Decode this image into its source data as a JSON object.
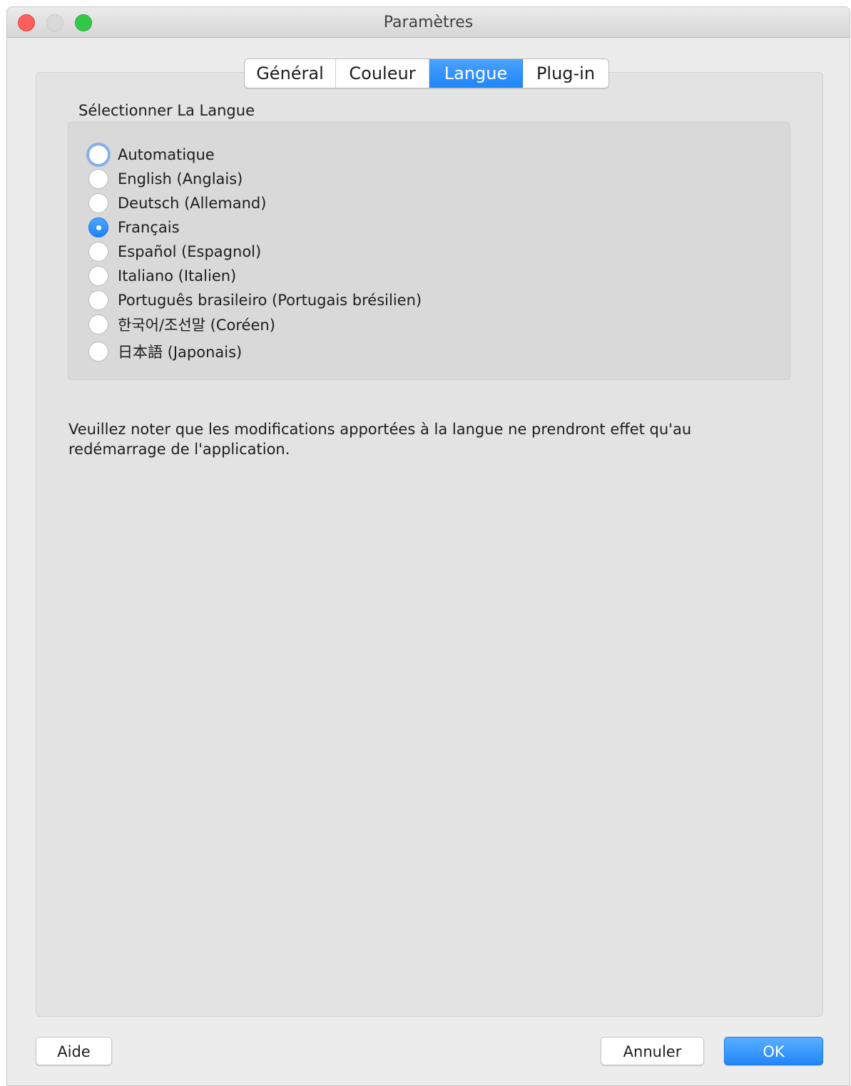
{
  "window": {
    "title": "Paramètres"
  },
  "tabs": [
    {
      "label": "Général",
      "selected": false
    },
    {
      "label": "Couleur",
      "selected": false
    },
    {
      "label": "Langue",
      "selected": true
    },
    {
      "label": "Plug-in",
      "selected": false
    }
  ],
  "language_section": {
    "label": "Sélectionner La Langue",
    "selected_value": "Français",
    "options": [
      {
        "label": "Automatique",
        "checked": false,
        "focused": true
      },
      {
        "label": "English (Anglais)",
        "checked": false,
        "focused": false
      },
      {
        "label": "Deutsch (Allemand)",
        "checked": false,
        "focused": false
      },
      {
        "label": "Français",
        "checked": true,
        "focused": false
      },
      {
        "label": "Español (Espagnol)",
        "checked": false,
        "focused": false
      },
      {
        "label": "Italiano (Italien)",
        "checked": false,
        "focused": false
      },
      {
        "label": "Português brasileiro (Portugais brésilien)",
        "checked": false,
        "focused": false
      },
      {
        "label": "한국어/조선말 (Coréen)",
        "checked": false,
        "focused": false
      },
      {
        "label": "日本語 (Japonais)",
        "checked": false,
        "focused": false
      }
    ]
  },
  "note": "Veuillez noter que les modifications apportées à la langue ne prendront effet qu'au redémarrage de l'application.",
  "buttons": {
    "help": "Aide",
    "cancel": "Annuler",
    "ok": "OK"
  },
  "colors": {
    "accent": "#1f84f7",
    "close": "#fc605c",
    "minimize": "#d9d9d9",
    "zoom": "#34c84a"
  }
}
